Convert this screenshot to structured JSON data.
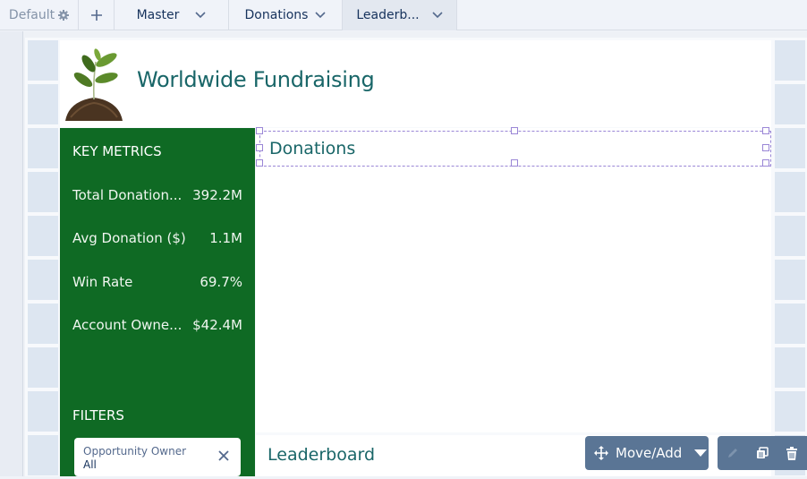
{
  "tabs": {
    "default_label": "Default",
    "default_icon": "gear-icon",
    "add_icon": "plus-icon",
    "items": [
      {
        "label": "Master",
        "icon": "chevron-down-icon"
      },
      {
        "label": "Donations",
        "icon": "chevron-down-icon"
      },
      {
        "label": "Leaderb...",
        "icon": "chevron-down-icon",
        "active": true
      }
    ]
  },
  "header": {
    "title": "Worldwide Fundraising",
    "logo": "seedling-in-soil-image"
  },
  "sidebar": {
    "metrics_heading": "KEY METRICS",
    "metrics": [
      {
        "label": "Total Donation...",
        "value": "392.2M"
      },
      {
        "label": "Avg Donation ($)",
        "value": "1.1M"
      },
      {
        "label": "Win Rate",
        "value": "69.7%"
      },
      {
        "label": "Account Owne...",
        "value": "$42.4M"
      }
    ],
    "filters_heading": "FILTERS",
    "filter": {
      "label": "Opportunity Owner",
      "value": "All",
      "clear_icon": "close-icon"
    }
  },
  "main": {
    "donations_title": "Donations",
    "leaderboard_title": "Leaderboard"
  },
  "toolbar": {
    "move_add_label": "Move/Add",
    "move_icon": "move-arrows-icon",
    "dropdown_icon": "caret-down-icon",
    "edit_icon": "pencil-icon",
    "clone_icon": "copy-icon",
    "delete_icon": "trash-icon"
  },
  "colors": {
    "sidebar_green": "#0f6a24",
    "title_teal": "#196668",
    "toolbar_slate": "#5a7595",
    "selection_purple": "#9a86d6"
  }
}
